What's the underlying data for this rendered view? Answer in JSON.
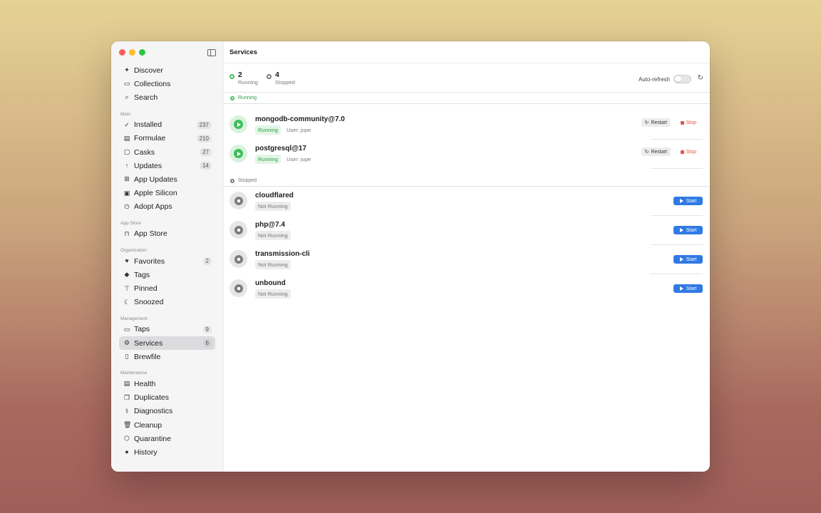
{
  "window": {
    "title": "Services"
  },
  "sidebar": {
    "top": [
      {
        "label": "Discover",
        "icon": "✦"
      },
      {
        "label": "Collections",
        "icon": "▭"
      },
      {
        "label": "Search",
        "icon": "⌕"
      }
    ],
    "sections": [
      {
        "label": "Main",
        "items": [
          {
            "label": "Installed",
            "icon": "✓",
            "badge": "237"
          },
          {
            "label": "Formulae",
            "icon": "▤",
            "badge": "210"
          },
          {
            "label": "Casks",
            "icon": "▢",
            "badge": "27"
          },
          {
            "label": "Updates",
            "icon": "↑",
            "badge": "14"
          },
          {
            "label": "App Updates",
            "icon": "⊞",
            "badge": ""
          },
          {
            "label": "Apple Silicon",
            "icon": "▣",
            "badge": ""
          },
          {
            "label": "Adopt Apps",
            "icon": "⏻",
            "badge": ""
          }
        ]
      },
      {
        "label": "App Store",
        "items": [
          {
            "label": "App Store",
            "icon": "⊓",
            "badge": ""
          }
        ]
      },
      {
        "label": "Organization",
        "items": [
          {
            "label": "Favorites",
            "icon": "♥",
            "badge": "2"
          },
          {
            "label": "Tags",
            "icon": "◆",
            "badge": ""
          },
          {
            "label": "Pinned",
            "icon": "⊤",
            "badge": ""
          },
          {
            "label": "Snoozed",
            "icon": "☾",
            "badge": ""
          }
        ]
      },
      {
        "label": "Management",
        "items": [
          {
            "label": "Taps",
            "icon": "▭",
            "badge": "9"
          },
          {
            "label": "Services",
            "icon": "⚙",
            "badge": "6",
            "active": true
          },
          {
            "label": "Brewfile",
            "icon": "▯",
            "badge": ""
          }
        ]
      },
      {
        "label": "Maintenance",
        "items": [
          {
            "label": "Health",
            "icon": "▤",
            "badge": ""
          },
          {
            "label": "Duplicates",
            "icon": "❐",
            "badge": ""
          },
          {
            "label": "Diagnostics",
            "icon": "⚕",
            "badge": ""
          },
          {
            "label": "Cleanup",
            "icon": "🗑",
            "badge": ""
          },
          {
            "label": "Quarantine",
            "icon": "⬡",
            "badge": ""
          },
          {
            "label": "History",
            "icon": "●",
            "badge": ""
          }
        ]
      }
    ]
  },
  "summary": {
    "running_count": "2",
    "running_label": "Running",
    "stopped_count": "4",
    "stopped_label": "Stopped",
    "auto_refresh_label": "Auto-refresh",
    "auto_refresh_on": false
  },
  "groups": {
    "running_label": "Running",
    "stopped_label": "Stopped"
  },
  "running_services": [
    {
      "name": "mongodb-community@7.0",
      "status": "Running",
      "user": "User: jupe"
    },
    {
      "name": "postgresql@17",
      "status": "Running",
      "user": "User: jupe"
    }
  ],
  "stopped_services": [
    {
      "name": "cloudflared",
      "status": "Not Running"
    },
    {
      "name": "php@7.4",
      "status": "Not Running"
    },
    {
      "name": "transmission-cli",
      "status": "Not Running"
    },
    {
      "name": "unbound",
      "status": "Not Running"
    }
  ],
  "buttons": {
    "restart": "Restart",
    "stop": "Stop",
    "start": "Start"
  },
  "colors": {
    "accent": "#2f7ae5",
    "running": "#3fbf5a",
    "stop": "#e0544a"
  }
}
